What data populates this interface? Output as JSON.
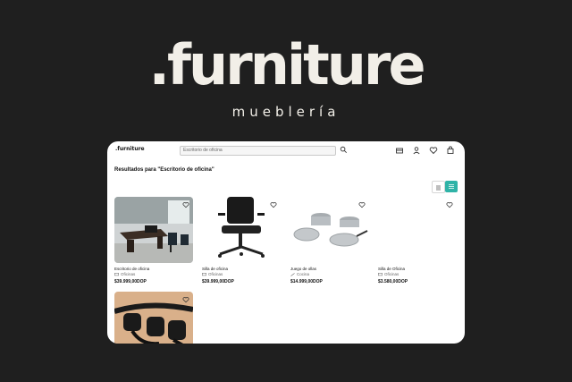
{
  "brand": {
    "logo": ".furniture",
    "tagline": "mueblería"
  },
  "app": {
    "logo": ".furniture",
    "search": {
      "value": "Escritorio de oficina"
    },
    "results_title": "Resultados para \"Escritorio de oficina\""
  },
  "icons": {
    "search": "search-icon",
    "cart_box": "store-icon",
    "user": "user-icon",
    "heart": "heart-icon",
    "bag": "bag-icon",
    "list": "list-view-icon",
    "grid": "grid-view-icon"
  },
  "colors": {
    "accent": "#2fb3a7",
    "background": "#1f1f1f",
    "logo": "#f2efe8"
  },
  "products": [
    {
      "name": "Escritorio de oficina",
      "category": "Oficinas",
      "price": "$39.999,00DOP"
    },
    {
      "name": "Silla de oficina",
      "category": "Oficinas",
      "price": "$39.999,00DOP"
    },
    {
      "name": "Juego de ollas",
      "category": "Cocina",
      "price": "$14.999,00DOP"
    },
    {
      "name": "Silla de Oficina",
      "category": "Oficinas",
      "price": "$3.580,00DOP"
    },
    {
      "name": "",
      "category": "",
      "price": ""
    }
  ]
}
